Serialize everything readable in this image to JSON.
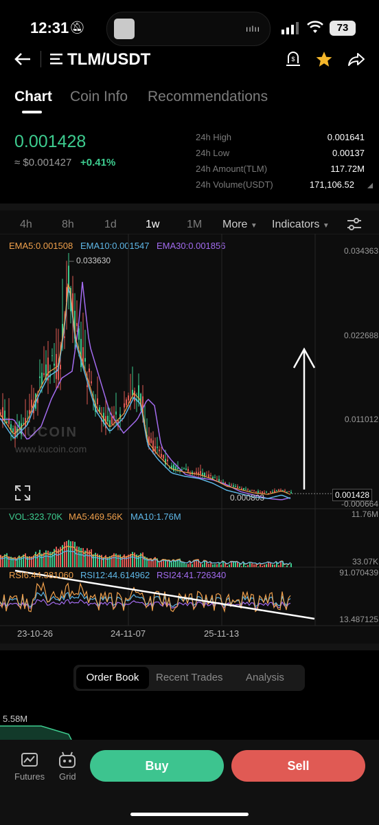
{
  "status_bar": {
    "time": "12:31",
    "battery": "73"
  },
  "header": {
    "pair": "TLM/USDT"
  },
  "tabs": [
    {
      "label": "Chart"
    },
    {
      "label": "Coin Info"
    },
    {
      "label": "Recommendations"
    }
  ],
  "price": {
    "last": "0.001428",
    "fiat": "≈ $0.001427",
    "change": "+0.41%"
  },
  "stats": [
    {
      "label": "24h High",
      "value": "0.001641"
    },
    {
      "label": "24h Low",
      "value": "0.00137"
    },
    {
      "label": "24h Amount(TLM)",
      "value": "117.72M"
    },
    {
      "label": "24h Volume(USDT)",
      "value": "171,106.52"
    }
  ],
  "intervals": [
    "4h",
    "8h",
    "1d",
    "1w",
    "1M"
  ],
  "active_interval": "1w",
  "toolbar": {
    "more": "More",
    "indicators": "Indicators"
  },
  "ema_legend": {
    "ema5": "EMA5:0.001508",
    "ema10": "EMA10:0.001547",
    "ema30": "EMA30:0.001856"
  },
  "price_axis": [
    "0.034363",
    "0.022688",
    "0.011012",
    "0.001428",
    "-0.000664"
  ],
  "annotations": {
    "high": "0.033630",
    "low": "0.000803"
  },
  "watermark": {
    "brand": "KUCOIN",
    "url": "www.kucoin.com"
  },
  "volume_legend": {
    "vol": "VOL:323.70K",
    "ma5": "MA5:469.56K",
    "ma10": "MA10:1.76M"
  },
  "volume_axis": [
    "11.76M",
    "33.07K"
  ],
  "rsi_legend": {
    "rsi6": "RSI6:44.381060",
    "rsi12": "RSI12:44.614962",
    "rsi24": "RSI24:41.726340"
  },
  "rsi_axis": [
    "91.070439",
    "13.487125"
  ],
  "dates": [
    "23-10-26",
    "24-11-07",
    "25-11-13"
  ],
  "bottom_tabs": [
    "Order Book",
    "Recent Trades",
    "Analysis"
  ],
  "depth_label": "5.58M",
  "nav": {
    "futures": "Futures",
    "grid": "Grid"
  },
  "actions": {
    "buy": "Buy",
    "sell": "Sell"
  },
  "colors": {
    "up": "#3dcc8f",
    "down": "#e05a54",
    "ema5": "#f0a04b",
    "ema10": "#5fb8e8",
    "ema30": "#a36cf0"
  }
}
